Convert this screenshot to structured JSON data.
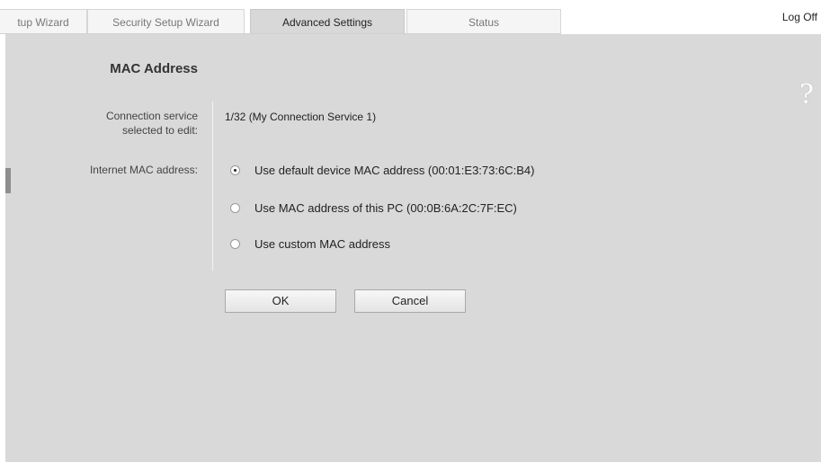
{
  "tabs": [
    {
      "label": "tup Wizard"
    },
    {
      "label": "Security Setup Wizard"
    },
    {
      "label": "Advanced Settings"
    },
    {
      "label": "Status"
    }
  ],
  "header": {
    "logoff_label": "Log Off",
    "help_label": "?"
  },
  "page": {
    "title": "MAC Address"
  },
  "form": {
    "connection_label": "Connection service selected to edit:",
    "connection_value": "1/32 (My Connection Service 1)",
    "mac_label": "Internet MAC address:",
    "selected_option": 0,
    "options": [
      {
        "label": "Use default device MAC address (00:01:E3:73:6C:B4)"
      },
      {
        "label": "Use MAC address of this PC (00:0B:6A:2C:7F:EC)"
      },
      {
        "label": "Use custom MAC address"
      }
    ]
  },
  "buttons": {
    "ok_label": "OK",
    "cancel_label": "Cancel"
  }
}
